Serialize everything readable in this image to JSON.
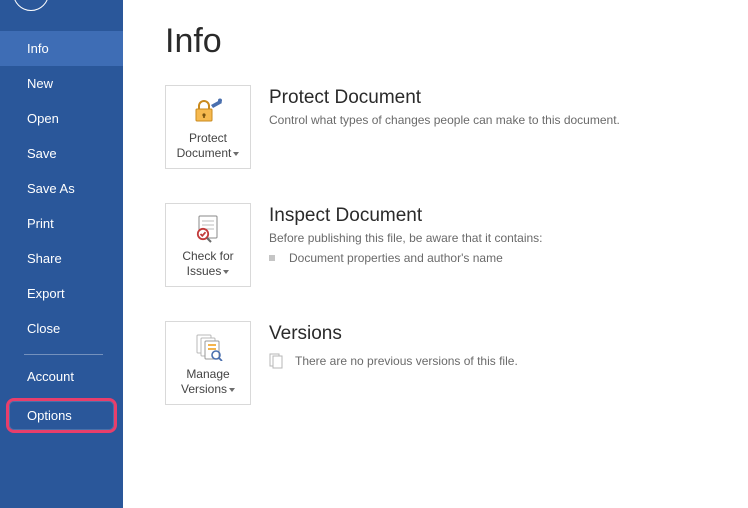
{
  "sidebar": {
    "items": [
      {
        "label": "Info",
        "selected": true
      },
      {
        "label": "New"
      },
      {
        "label": "Open"
      },
      {
        "label": "Save"
      },
      {
        "label": "Save As"
      },
      {
        "label": "Print"
      },
      {
        "label": "Share"
      },
      {
        "label": "Export"
      },
      {
        "label": "Close"
      }
    ],
    "account_label": "Account",
    "options_label": "Options"
  },
  "page": {
    "title": "Info"
  },
  "sections": {
    "protect": {
      "tile_line1": "Protect",
      "tile_line2": "Document",
      "title": "Protect Document",
      "text": "Control what types of changes people can make to this document."
    },
    "inspect": {
      "tile_line1": "Check for",
      "tile_line2": "Issues",
      "title": "Inspect Document",
      "text": "Before publishing this file, be aware that it contains:",
      "bullet1": "Document properties and author's name"
    },
    "versions": {
      "tile_line1": "Manage",
      "tile_line2": "Versions",
      "title": "Versions",
      "text": "There are no previous versions of this file."
    }
  }
}
